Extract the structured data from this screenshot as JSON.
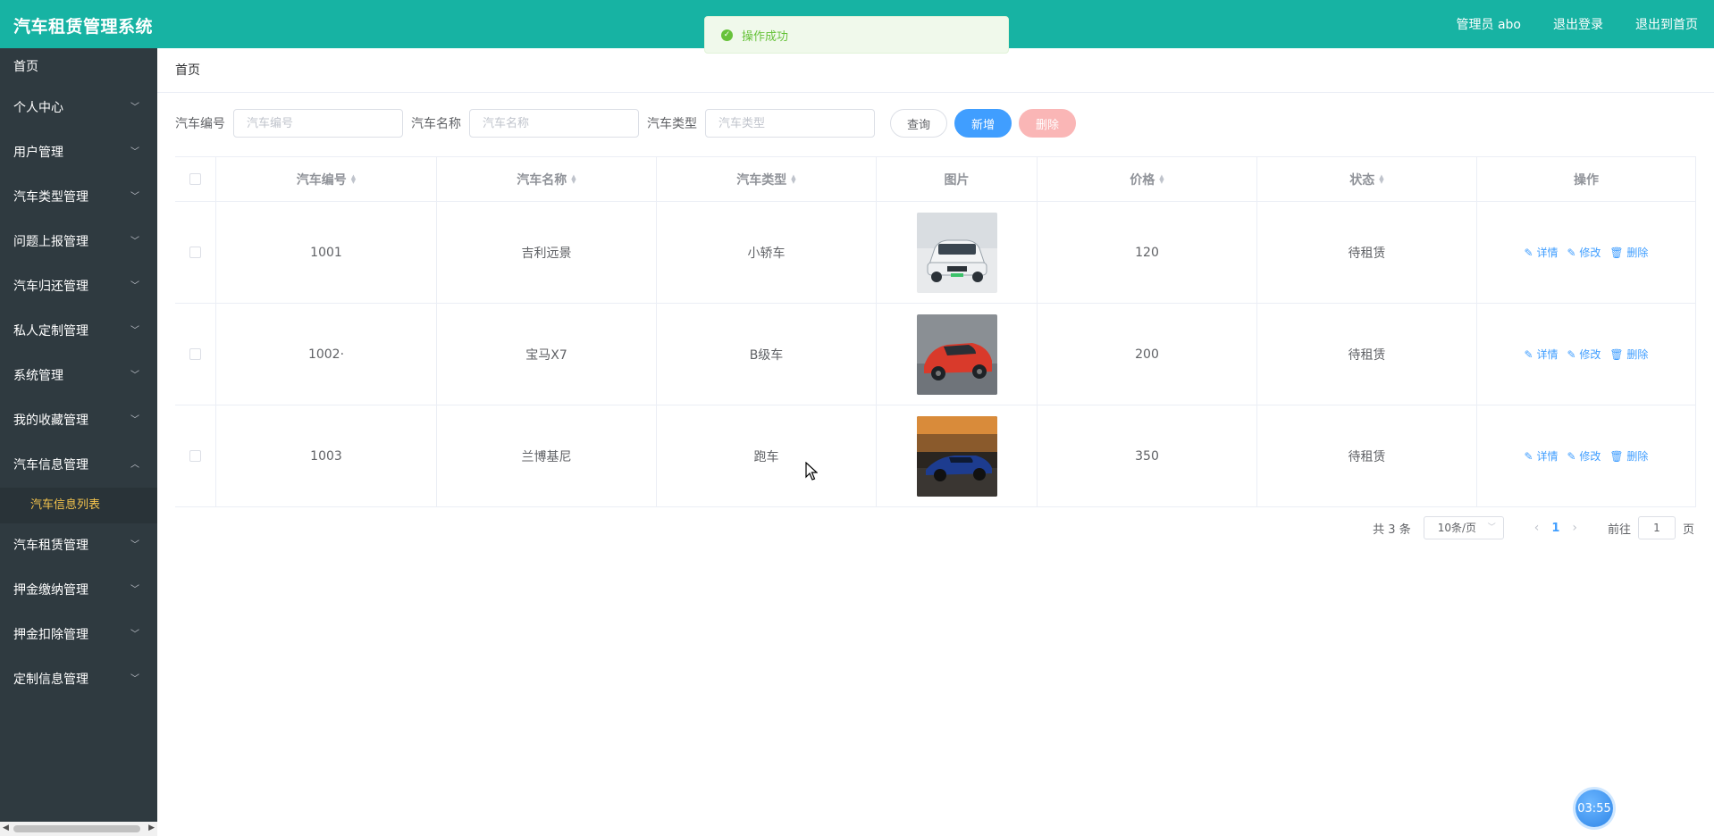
{
  "header": {
    "title": "汽车租赁管理系统",
    "user": "管理员 abo",
    "logout": "退出登录",
    "home": "退出到首页"
  },
  "toast": {
    "message": "操作成功"
  },
  "sidebar": {
    "items": [
      {
        "label": "首页"
      },
      {
        "label": "个人中心"
      },
      {
        "label": "用户管理"
      },
      {
        "label": "汽车类型管理"
      },
      {
        "label": "问题上报管理"
      },
      {
        "label": "汽车归还管理"
      },
      {
        "label": "私人定制管理"
      },
      {
        "label": "系统管理"
      },
      {
        "label": "我的收藏管理"
      },
      {
        "label": "汽车信息管理"
      },
      {
        "label": "汽车租赁管理"
      },
      {
        "label": "押金缴纳管理"
      },
      {
        "label": "押金扣除管理"
      },
      {
        "label": "定制信息管理"
      }
    ],
    "active_sub": "汽车信息列表"
  },
  "breadcrumb": "首页",
  "search": {
    "car_no_label": "汽车编号",
    "car_no_placeholder": "汽车编号",
    "car_name_label": "汽车名称",
    "car_name_placeholder": "汽车名称",
    "car_type_label": "汽车类型",
    "car_type_placeholder": "汽车类型",
    "query": "查询",
    "add": "新增",
    "delete": "删除"
  },
  "table": {
    "headers": [
      "汽车编号",
      "汽车名称",
      "汽车类型",
      "图片",
      "价格",
      "状态",
      "操作"
    ],
    "rows": [
      {
        "no": "1001",
        "name": "吉利远景",
        "type": "小轿车",
        "price": "120",
        "status": "待租赁"
      },
      {
        "no": "1002·",
        "name": "宝马X7",
        "type": "B级车",
        "price": "200",
        "status": "待租赁"
      },
      {
        "no": "1003",
        "name": "兰博基尼",
        "type": "跑车",
        "price": "350",
        "status": "待租赁"
      }
    ],
    "op_detail": "详情",
    "op_edit": "修改",
    "op_delete": "删除"
  },
  "pager": {
    "total": "共 3 条",
    "page_size": "10条/页",
    "current": "1",
    "goto": "前往",
    "goto_value": "1",
    "page_unit": "页"
  },
  "timer": "03:55"
}
